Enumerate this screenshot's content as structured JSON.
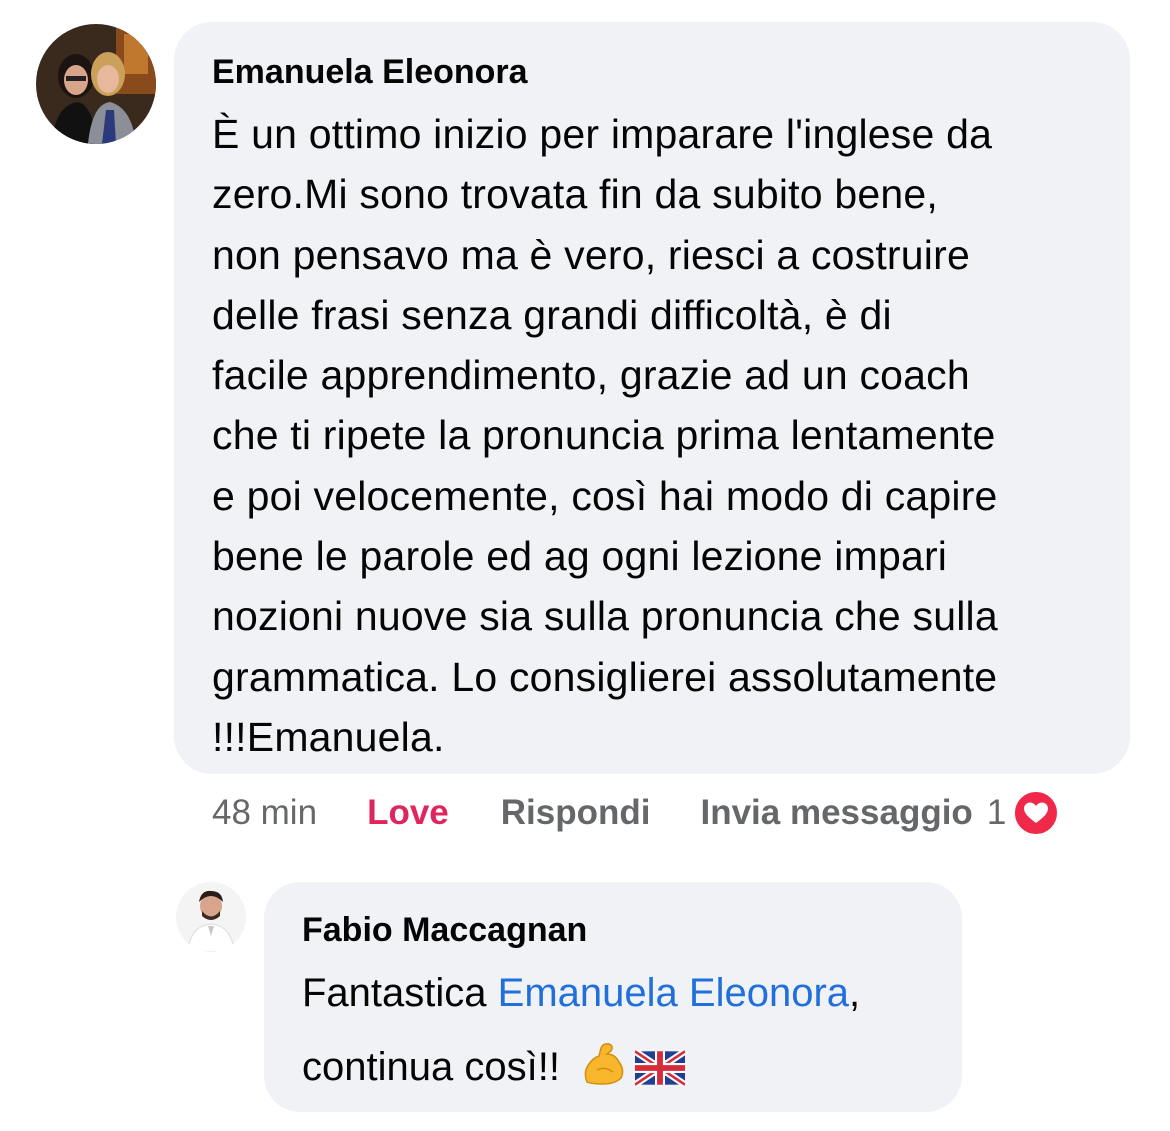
{
  "comment": {
    "author": "Emanuela Eleonora",
    "text": "È  un ottimo inizio per imparare l'inglese da\nzero.Mi sono trovata fin da subito bene,\nnon pensavo ma è vero, riesci a costruire\ndelle frasi senza grandi difficoltà,  è di\nfacile apprendimento,  grazie ad un coach\nche ti ripete la pronuncia prima lentamente\ne poi velocemente,  così hai modo di capire\nbene le parole ed ag ogni lezione impari\nnozioni nuove sia sulla pronuncia che sulla\ngrammatica. Lo consiglierei assolutamente\n!!!Emanuela.",
    "time": "48 min",
    "love_label": "Love",
    "reply_label": "Rispondi",
    "message_label": "Invia messaggio",
    "reaction_count": "1",
    "reaction_icon": "heart-icon",
    "reaction_color": "#f0284a"
  },
  "reply": {
    "author": "Fabio Maccagnan",
    "text_before": "Fantastica ",
    "mention": "Emanuela Eleonora",
    "text_after": ",",
    "line2": "continua così!!",
    "emojis": [
      "flexed-biceps-icon",
      "uk-flag-icon"
    ]
  },
  "colors": {
    "bubble": "#f0f2f5",
    "mention": "#216fdb",
    "love": "#e0245e",
    "meta": "#65676b"
  }
}
